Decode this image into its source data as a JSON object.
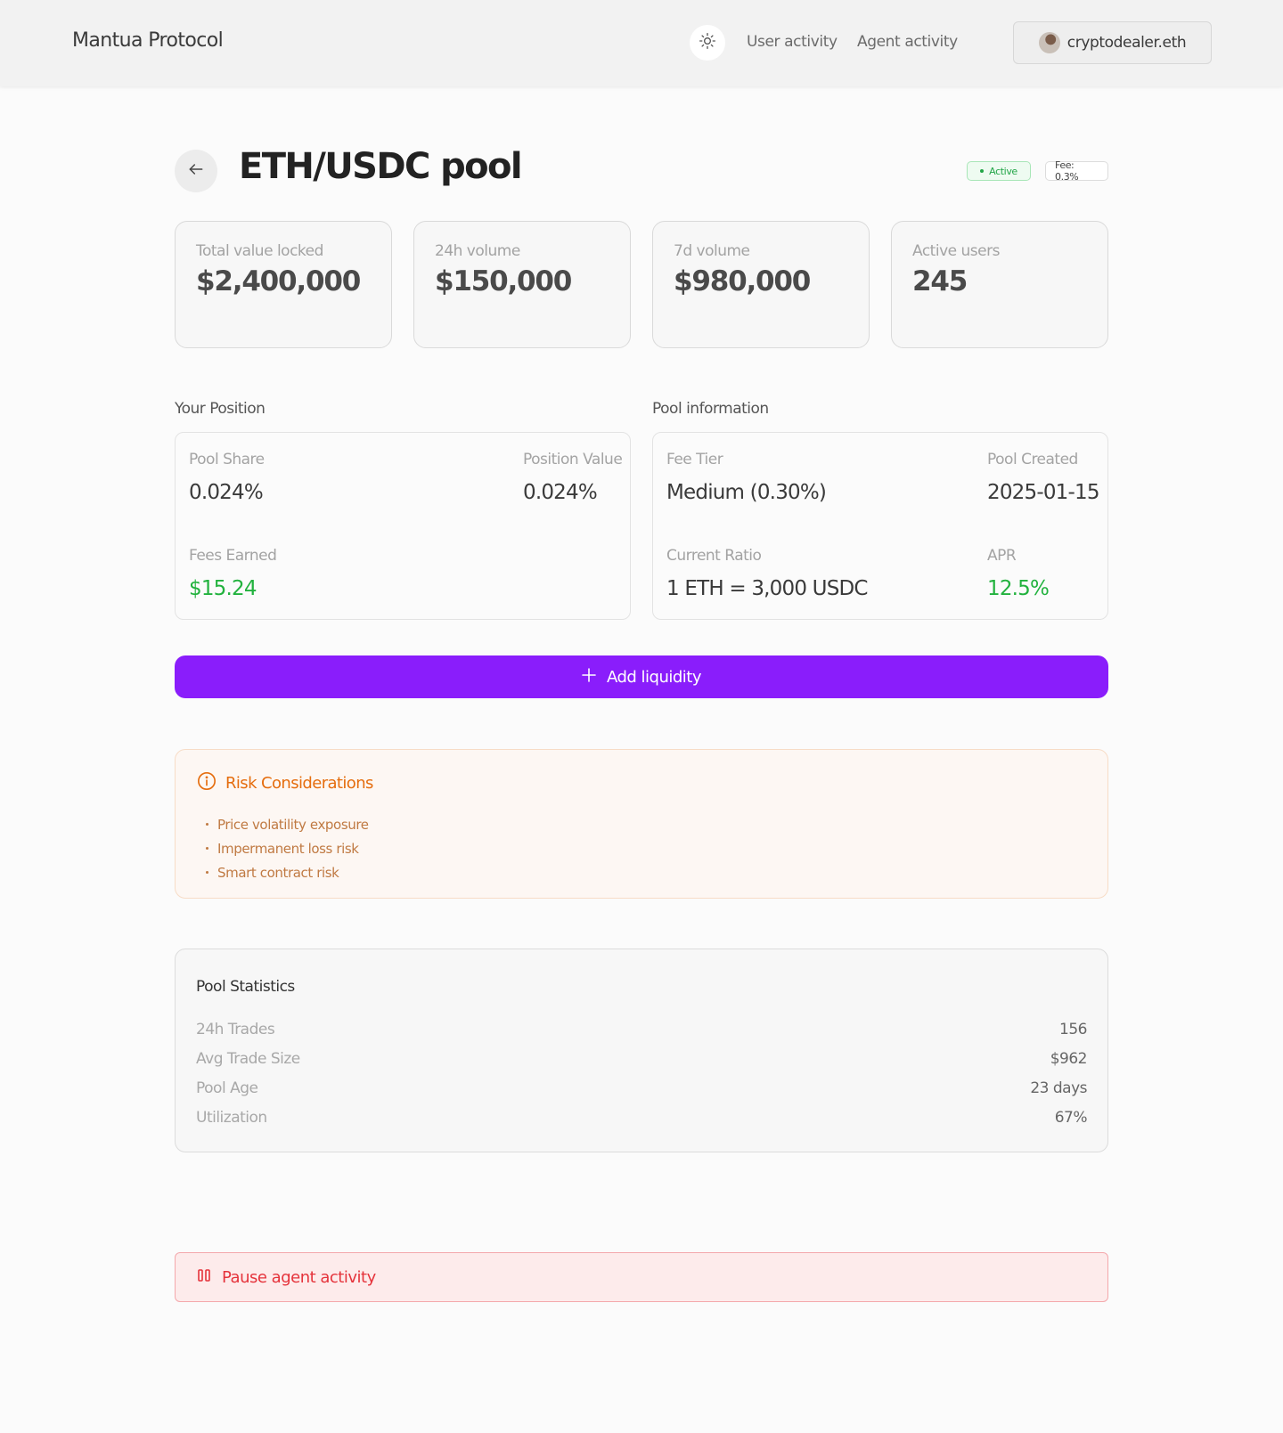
{
  "header": {
    "brand": "Mantua Protocol",
    "nav": [
      "User activity",
      "Agent activity"
    ],
    "wallet": "cryptodealer.eth",
    "icons": {
      "theme": "sun-icon",
      "avatar": "avatar"
    }
  },
  "pool": {
    "title": "ETH/USDC pool",
    "status": "Active",
    "fee_badge": "Fee: 0.3%"
  },
  "stats": [
    {
      "label": "Total value locked",
      "value": "$2,400,000"
    },
    {
      "label": "24h volume",
      "value": "$150,000"
    },
    {
      "label": "7d volume",
      "value": "$980,000"
    },
    {
      "label": "Active users",
      "value": "245"
    }
  ],
  "position": {
    "title": "Your Position",
    "pool_share_label": "Pool Share",
    "pool_share": "0.024%",
    "position_value_label": "Position Value",
    "position_value": "0.024%",
    "fees_earned_label": "Fees Earned",
    "fees_earned": "$15.24"
  },
  "pool_info": {
    "title": "Pool information",
    "fee_tier_label": "Fee Tier",
    "fee_tier": "Medium (0.30%)",
    "created_label": "Pool Created",
    "created": "2025-01-15",
    "ratio_label": "Current Ratio",
    "ratio": "1 ETH = 3,000 USDC",
    "apr_label": "APR",
    "apr": "12.5%"
  },
  "actions": {
    "add_liquidity": "Add liquidity",
    "pause_agent": "Pause agent activity"
  },
  "risk": {
    "title": "Risk Considerations",
    "items": [
      "Price volatility exposure",
      "Impermanent loss risk",
      "Smart contract risk"
    ]
  },
  "pool_stats": {
    "title": "Pool Statistics",
    "rows": [
      {
        "label": "24h Trades",
        "value": "156"
      },
      {
        "label": "Avg Trade Size",
        "value": "$962"
      },
      {
        "label": "Pool Age",
        "value": "23 days"
      },
      {
        "label": "Utilization",
        "value": "67%"
      }
    ]
  },
  "colors": {
    "accent": "#8a1dfb",
    "positive": "#22b23e",
    "warning": "#e56d0e",
    "danger": "#e5333b"
  }
}
